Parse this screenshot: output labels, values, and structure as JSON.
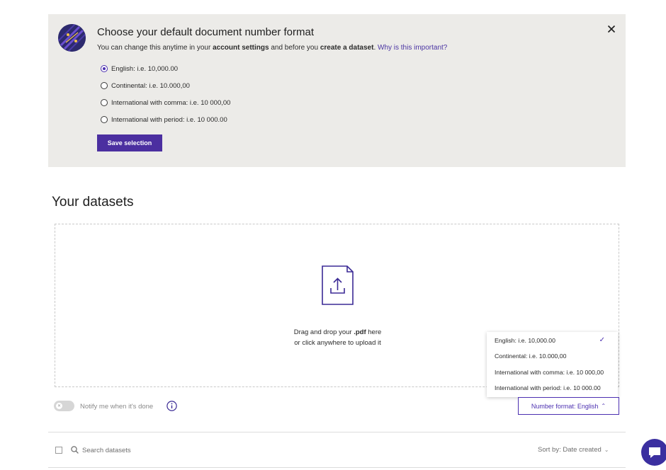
{
  "banner": {
    "title": "Choose your default document number format",
    "subtitle_prefix": "You can change this anytime in your ",
    "subtitle_bold1": "account settings",
    "subtitle_mid": " and before you ",
    "subtitle_bold2": "create a dataset",
    "subtitle_after": ". ",
    "subtitle_link": "Why is this important?",
    "options": [
      {
        "label": "English: i.e. 10,000.00",
        "checked": true
      },
      {
        "label": "Continental: i.e. 10.000,00",
        "checked": false
      },
      {
        "label": "International with comma: i.e. 10 000,00",
        "checked": false
      },
      {
        "label": "International with period: i.e. 10 000.00",
        "checked": false
      }
    ],
    "save_label": "Save selection",
    "logo_icon": "brand-logo-icon",
    "close_icon": "close-icon"
  },
  "datasets": {
    "title": "Your datasets",
    "upload_icon": "file-upload-icon",
    "drop_line1_prefix": "Drag and drop your ",
    "drop_line1_bold": ".pdf",
    "drop_line1_suffix": " here",
    "drop_line2": "or click anywhere to upload it"
  },
  "number_format_menu": {
    "items": [
      {
        "label": "English: i.e. 10,000.00",
        "selected": true
      },
      {
        "label": "Continental: i.e. 10.000,00",
        "selected": false
      },
      {
        "label": "International with comma: i.e. 10 000,00",
        "selected": false
      },
      {
        "label": "International with period: i.e. 10 000.00",
        "selected": false
      }
    ],
    "check_glyph": "✓",
    "button_label": "Number format: English",
    "button_chevron": "⌃"
  },
  "notify": {
    "label": "Notify me when it's done",
    "enabled": false,
    "toggle_glyph": "✕",
    "info_icon": "info-icon"
  },
  "list": {
    "search_placeholder": "Search datasets",
    "sort_label": "Sort by: Date created",
    "sort_chevron": "⌄"
  },
  "colors": {
    "accent": "#4b2fb0",
    "banner_bg": "#ecebe8",
    "chat_bg": "#3b2fa0"
  }
}
